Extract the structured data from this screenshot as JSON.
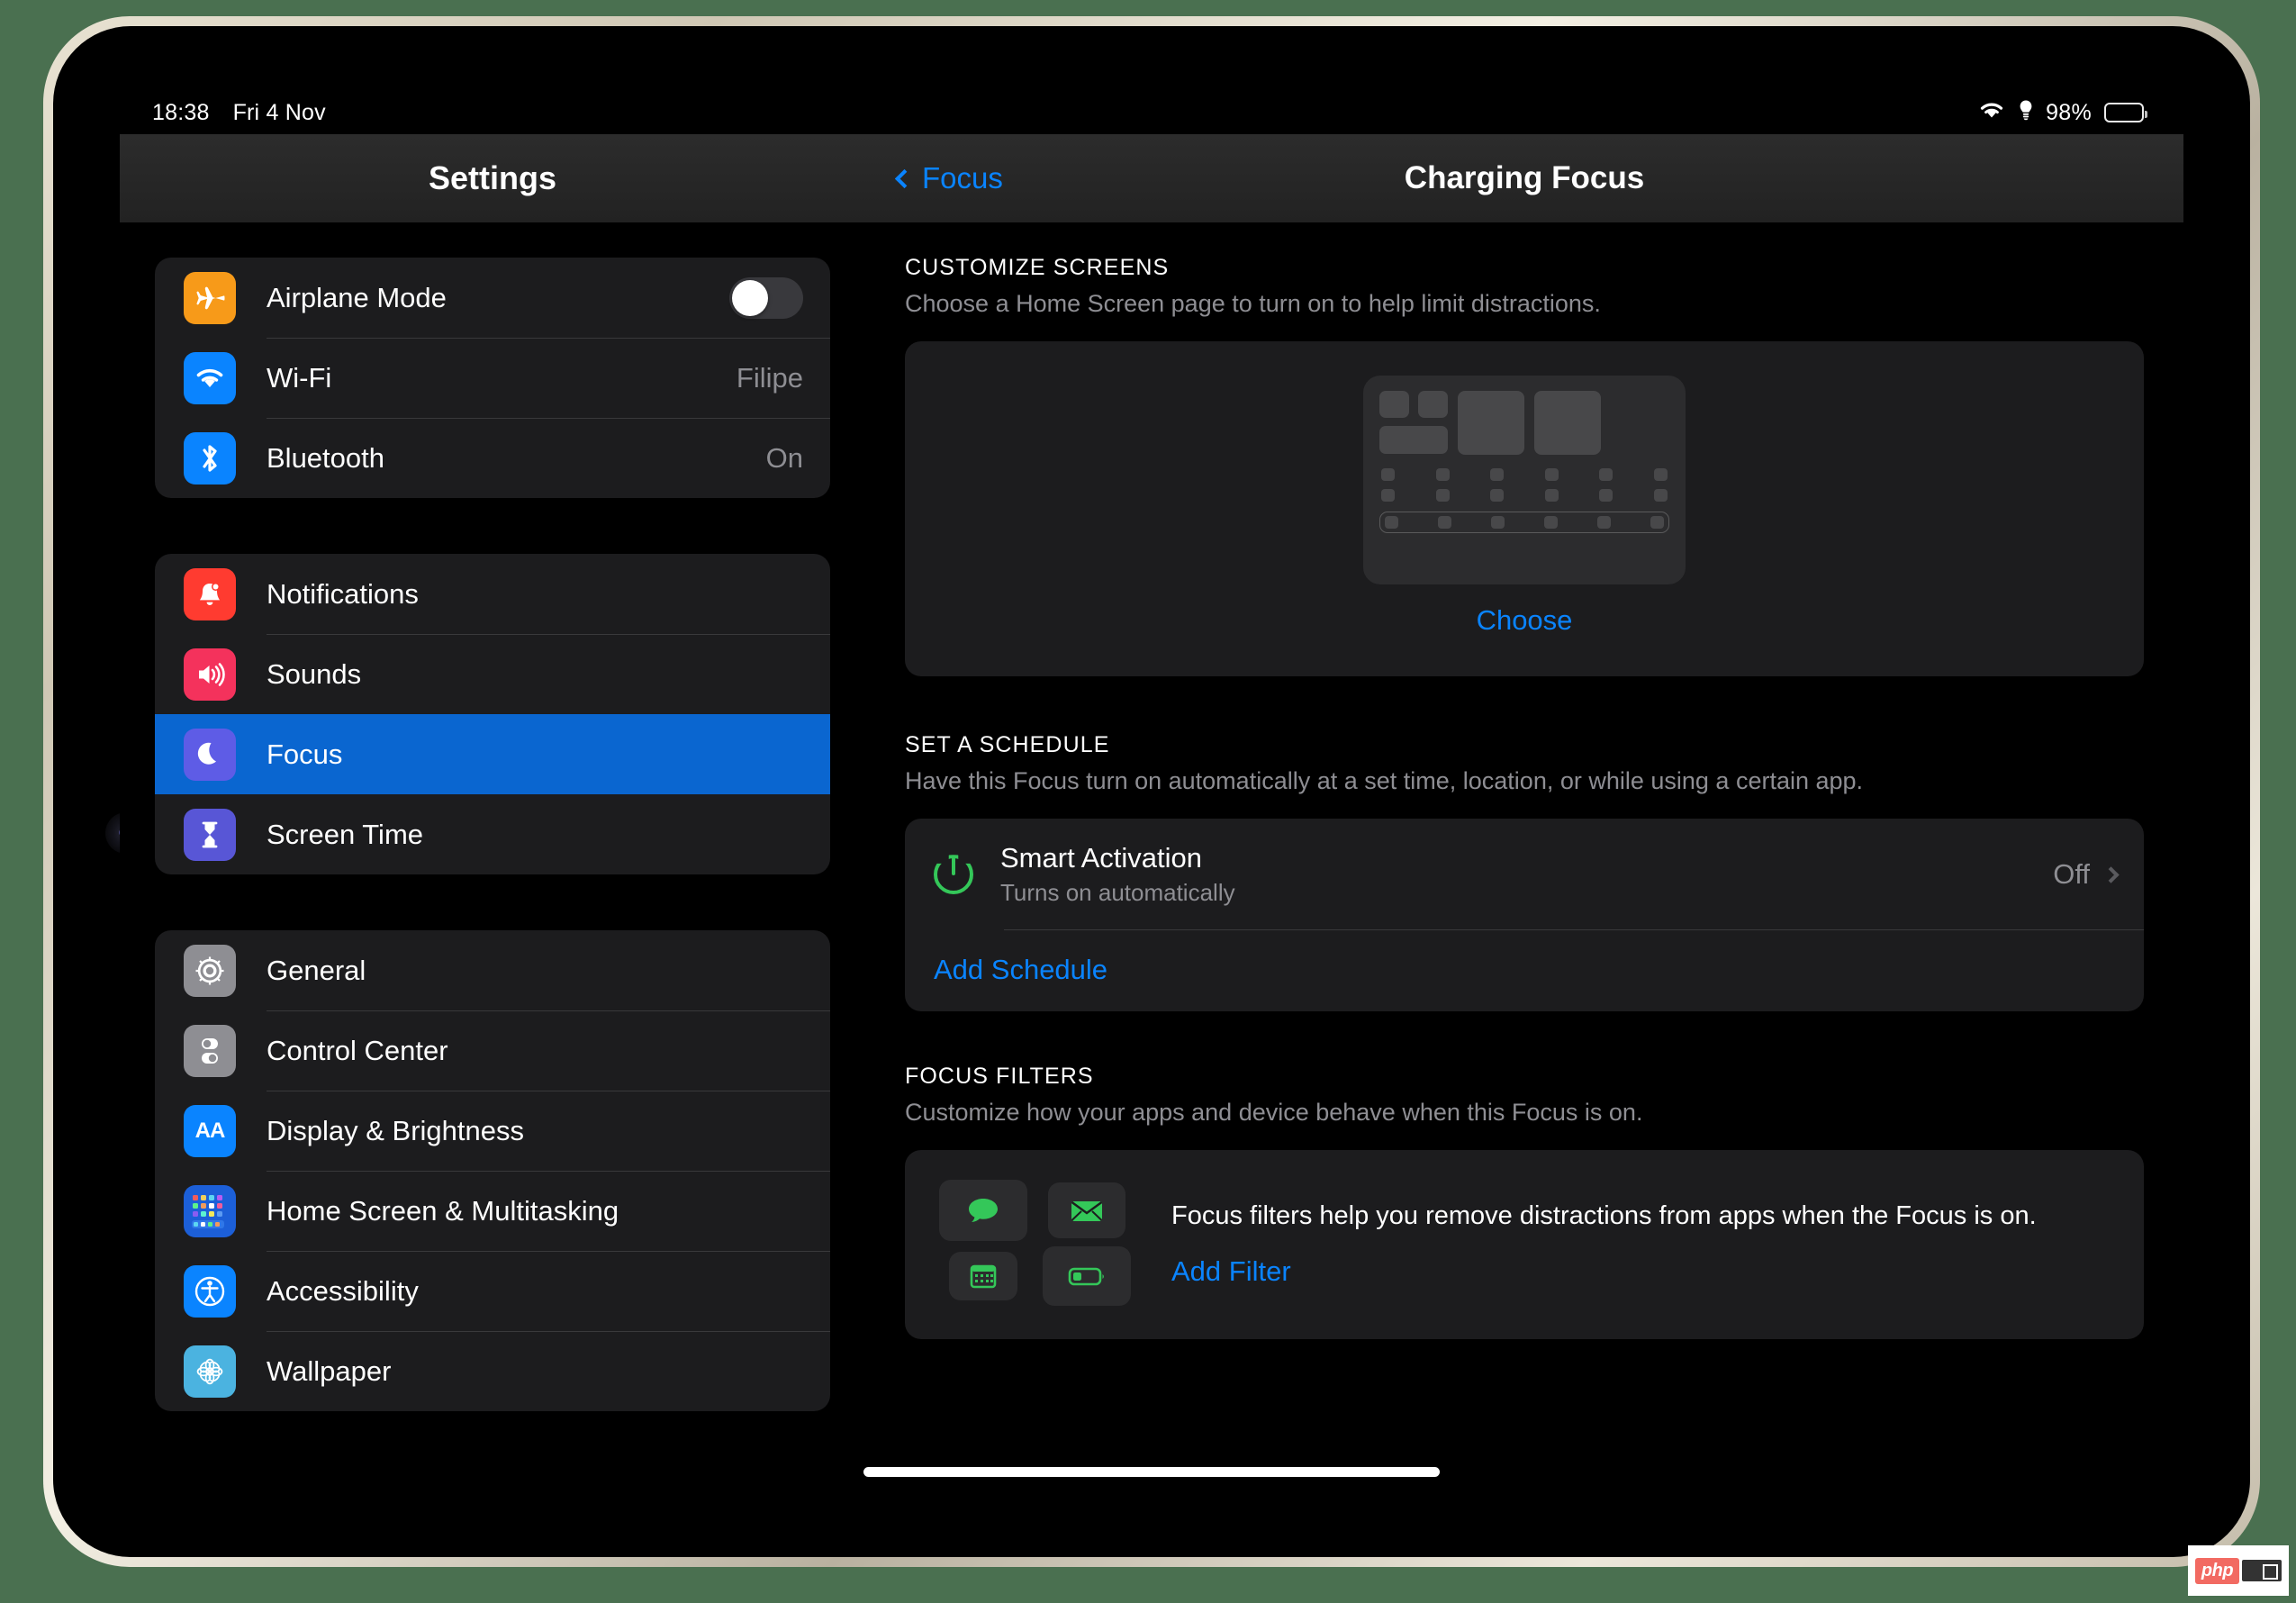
{
  "statusbar": {
    "time": "18:38",
    "date": "Fri 4 Nov",
    "battery_percent": "98%",
    "wifi_icon": "wifi-icon",
    "location_icon": "location-icon",
    "battery_icon": "battery-full-icon"
  },
  "sidebar": {
    "title": "Settings",
    "groups": [
      {
        "items": [
          {
            "label": "Airplane Mode",
            "icon": "airplane-icon",
            "accessory": "toggle",
            "toggle_on": false,
            "icon_color": "#f79a19"
          },
          {
            "label": "Wi-Fi",
            "icon": "wifi-icon",
            "value": "Filipe",
            "icon_color": "#0a84ff"
          },
          {
            "label": "Bluetooth",
            "icon": "bluetooth-icon",
            "value": "On",
            "icon_color": "#0a84ff"
          }
        ]
      },
      {
        "items": [
          {
            "label": "Notifications",
            "icon": "bell-icon",
            "icon_color": "#ff3b30"
          },
          {
            "label": "Sounds",
            "icon": "speaker-icon",
            "icon_color": "#f4325c"
          },
          {
            "label": "Focus",
            "icon": "moon-icon",
            "icon_color": "#5e5ce6",
            "selected": true
          },
          {
            "label": "Screen Time",
            "icon": "hourglass-icon",
            "icon_color": "#5856d6"
          }
        ]
      },
      {
        "items": [
          {
            "label": "General",
            "icon": "gear-icon",
            "icon_color": "#8e8e93"
          },
          {
            "label": "Control Center",
            "icon": "sliders-icon",
            "icon_color": "#8e8e93"
          },
          {
            "label": "Display & Brightness",
            "icon": "aa-icon",
            "icon_color": "#0a84ff"
          },
          {
            "label": "Home Screen & Multitasking",
            "icon": "home-screen-grid-icon",
            "icon_color": "#1c5fd8"
          },
          {
            "label": "Accessibility",
            "icon": "accessibility-icon",
            "icon_color": "#0a84ff"
          },
          {
            "label": "Wallpaper",
            "icon": "wallpaper-flower-icon",
            "icon_color": "#4bb3e0"
          }
        ]
      }
    ]
  },
  "navbar": {
    "back_label": "Focus",
    "back_icon": "chevron-left-icon",
    "title": "Charging Focus"
  },
  "detail": {
    "customize_screens": {
      "header": "CUSTOMIZE SCREENS",
      "subtitle": "Choose a Home Screen page to turn on to help limit distractions.",
      "choose_label": "Choose",
      "preview_icon": "home-screen-preview"
    },
    "set_schedule": {
      "header": "SET A SCHEDULE",
      "subtitle": "Have this Focus turn on automatically at a set time, location, or while using a certain app.",
      "smart_activation": {
        "title": "Smart Activation",
        "subtitle": "Turns on automatically",
        "value": "Off",
        "icon": "power-icon",
        "icon_color": "#34c759",
        "chevron": "chevron-right-icon"
      },
      "add_schedule_label": "Add Schedule"
    },
    "focus_filters": {
      "header": "FOCUS FILTERS",
      "subtitle": "Customize how your apps and device behave when this Focus is on.",
      "description": "Focus filters help you remove distractions from apps when the Focus is on.",
      "add_filter_label": "Add Filter",
      "filter_icons": [
        {
          "name": "messages-bubble-icon",
          "color": "#34c759"
        },
        {
          "name": "mail-envelope-icon",
          "color": "#34c759"
        },
        {
          "name": "calendar-icon",
          "color": "#34c759"
        },
        {
          "name": "low-power-battery-icon",
          "color": "#34c759"
        }
      ]
    }
  },
  "colors": {
    "accent_blue": "#0a84ff",
    "selection_blue": "#0a66d0",
    "green": "#34c759",
    "card_bg": "#1c1c1e",
    "background_green": "#4a7050"
  },
  "watermark": {
    "label": "php"
  }
}
